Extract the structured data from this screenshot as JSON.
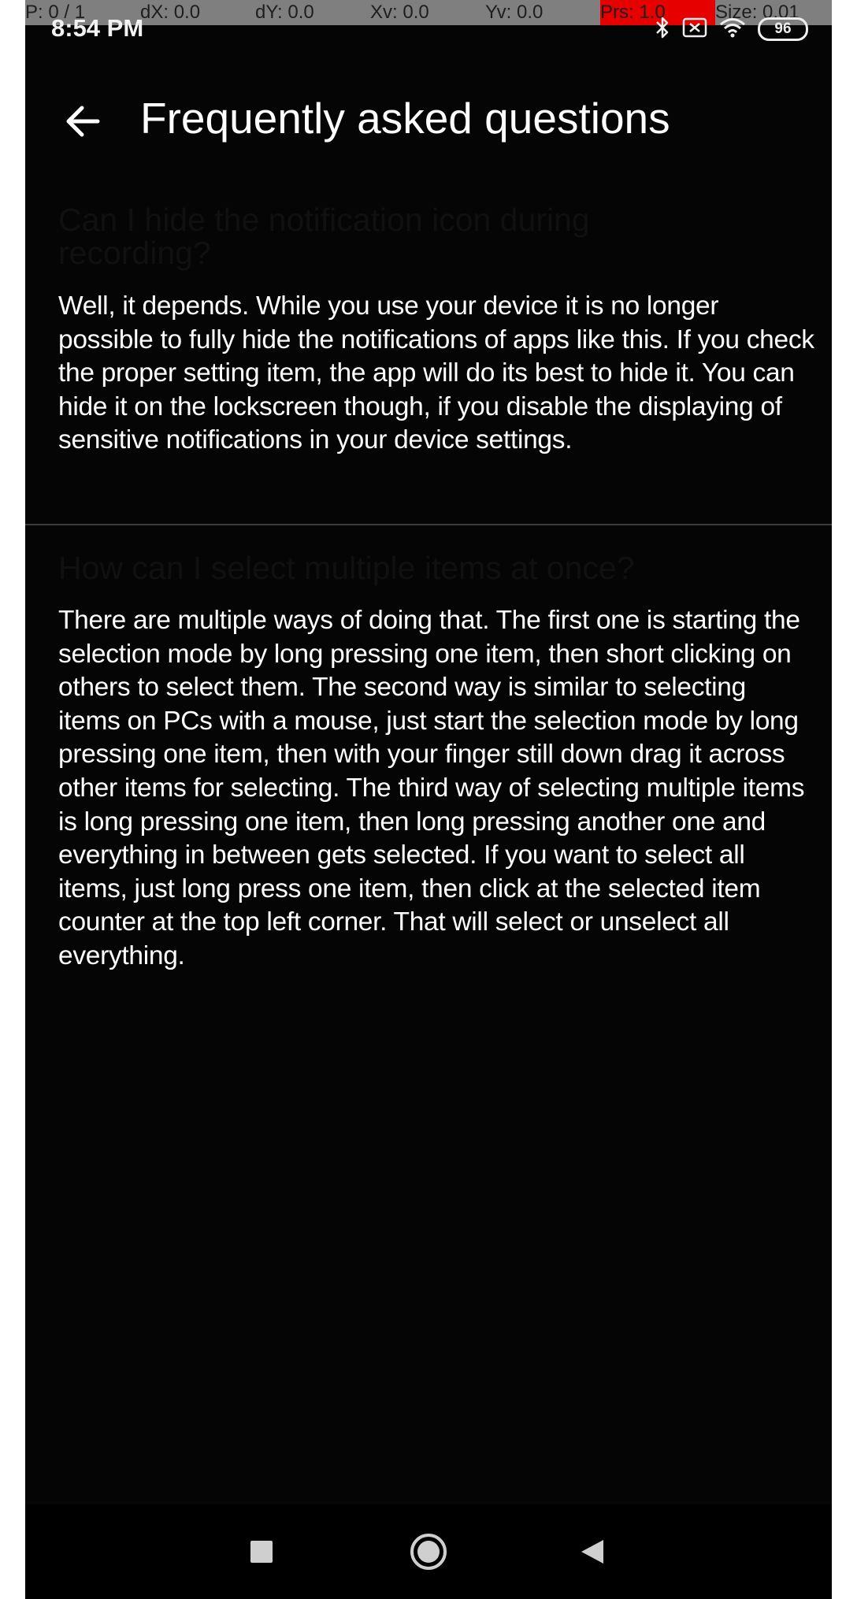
{
  "pointer_overlay": {
    "cells": [
      "P: 0 / 1",
      "dX: 0.0",
      "dY: 0.0",
      "Xv: 0.0",
      "Yv: 0.0",
      "Prs: 1.0",
      "Size: 0.01"
    ]
  },
  "status_bar": {
    "time": "8:54 PM",
    "battery": "96",
    "icons": [
      "bluetooth-icon",
      "notification-icon",
      "wifi-icon",
      "battery-icon"
    ]
  },
  "app_bar": {
    "title": "Frequently asked questions",
    "back_icon": "arrow-left-icon"
  },
  "faq": [
    {
      "question": "Can I hide the notification icon during recording?",
      "answer": "Well, it depends. While you use your device it is no longer possible to fully hide the notifications of apps like this. If you check the proper setting item, the app will do its best to hide it. You can hide it on the lockscreen though, if you disable the displaying of sensitive notifications in your device settings."
    },
    {
      "question": "How can I select multiple items at once?",
      "answer": "There are multiple ways of doing that. The first one is starting the selection mode by long pressing one item, then short clicking on others to select them. The second way is similar to selecting items on PCs with a mouse, just start the selection mode by long pressing one item, then with your finger still down drag it across other items for selecting. The third way of selecting multiple items is long pressing one item, then long pressing another one and everything in between gets selected. If you want to select all items, just long press one item, then click at the selected item counter at the top left corner. That will select or unselect all everything."
    }
  ],
  "nav_bar": {
    "buttons": [
      "recents-icon",
      "home-icon",
      "back-icon"
    ]
  },
  "colors": {
    "background": "#050505",
    "text": "#ffffff",
    "question_text": "#101010",
    "pointer_highlight": "#e60000"
  }
}
